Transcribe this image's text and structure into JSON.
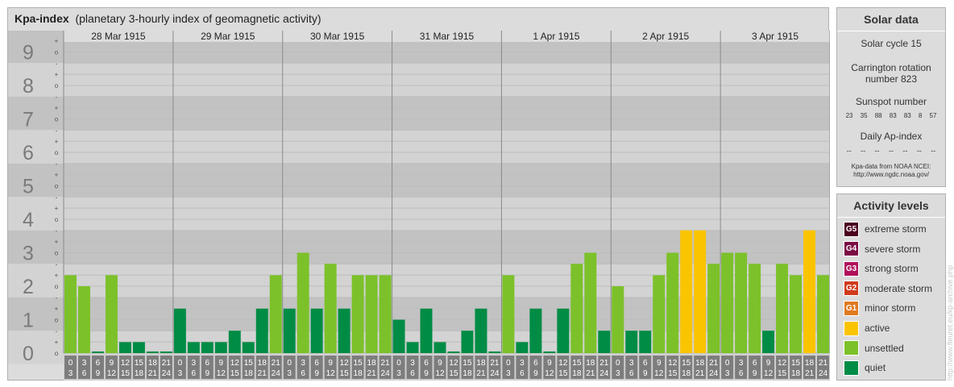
{
  "title": {
    "main": "Kpa-index",
    "sub": "(planetary 3-hourly index of geomagnetic activity)"
  },
  "chart_data": {
    "type": "bar",
    "title": "Kpa-index (planetary 3-hourly index of geomagnetic activity)",
    "days": [
      "28 Mar 1915",
      "29 Mar 1915",
      "30 Mar 1915",
      "31 Mar 1915",
      "1 Apr 1915",
      "2 Apr 1915",
      "3 Apr 1915"
    ],
    "intervals": [
      [
        "0",
        "3"
      ],
      [
        "3",
        "6"
      ],
      [
        "6",
        "9"
      ],
      [
        "9",
        "12"
      ],
      [
        "12",
        "15"
      ],
      [
        "15",
        "18"
      ],
      [
        "18",
        "21"
      ],
      [
        "21",
        "24"
      ]
    ],
    "y_major": [
      "0",
      "1",
      "2",
      "3",
      "4",
      "5",
      "6",
      "7",
      "8",
      "9"
    ],
    "y_minor": [
      "+",
      "o",
      "-"
    ],
    "ylim": [
      0,
      9.33
    ],
    "values": [
      [
        2.33,
        2.0,
        0,
        2.33,
        0.33,
        0.33,
        0,
        0
      ],
      [
        1.33,
        0.33,
        0.33,
        0.33,
        0.67,
        0.33,
        1.33,
        2.33
      ],
      [
        1.33,
        3.0,
        1.33,
        2.67,
        1.33,
        2.33,
        2.33,
        2.33
      ],
      [
        1.0,
        0.33,
        1.33,
        0.33,
        0,
        0.67,
        1.33,
        0
      ],
      [
        2.33,
        0.33,
        1.33,
        0,
        1.33,
        2.67,
        3.0,
        0.67
      ],
      [
        2.0,
        0.67,
        0.67,
        2.33,
        3.0,
        3.67,
        3.67,
        2.67
      ],
      [
        3.0,
        3.0,
        2.67,
        0.67,
        2.67,
        2.33,
        3.67,
        2.33
      ]
    ],
    "colors": {
      "quiet": "#008c45",
      "unsettled": "#7cc12a",
      "active": "#fac400",
      "minor_storm": "#e07b20",
      "moderate_storm": "#d13a1c",
      "strong_storm": "#b0105a",
      "severe_storm": "#7a0c44",
      "extreme_storm": "#4a0020"
    },
    "grid": true
  },
  "solar": {
    "heading": "Solar data",
    "cycle": "Solar cycle 15",
    "carrington_1": "Carrington rotation",
    "carrington_2": "number 823",
    "sunspot_label": "Sunspot number",
    "sunspots": [
      "23",
      "35",
      "88",
      "83",
      "83",
      "8",
      "57"
    ],
    "ap_label": "Daily Ap-index",
    "ap_values": [
      "--",
      "--",
      "--",
      "--",
      "--",
      "--",
      "--"
    ],
    "source_1": "Kpa-data from NOAA NCEI:",
    "source_2": "http://www.ngdc.noaa.gov/"
  },
  "activity": {
    "heading": "Activity levels",
    "levels": [
      {
        "badge": "G5",
        "label": "extreme storm",
        "color": "#4a0020"
      },
      {
        "badge": "G4",
        "label": "severe storm",
        "color": "#7a0c44"
      },
      {
        "badge": "G3",
        "label": "strong storm",
        "color": "#b0105a"
      },
      {
        "badge": "G2",
        "label": "moderate storm",
        "color": "#d13a1c"
      },
      {
        "badge": "G1",
        "label": "minor storm",
        "color": "#e07b20"
      },
      {
        "badge": "",
        "label": "active",
        "color": "#fac400"
      },
      {
        "badge": "",
        "label": "unsettled",
        "color": "#7cc12a"
      },
      {
        "badge": "",
        "label": "quiet",
        "color": "#008c45"
      }
    ]
  },
  "watermark": "http://www.fleuret.eu/kp-archive.php"
}
